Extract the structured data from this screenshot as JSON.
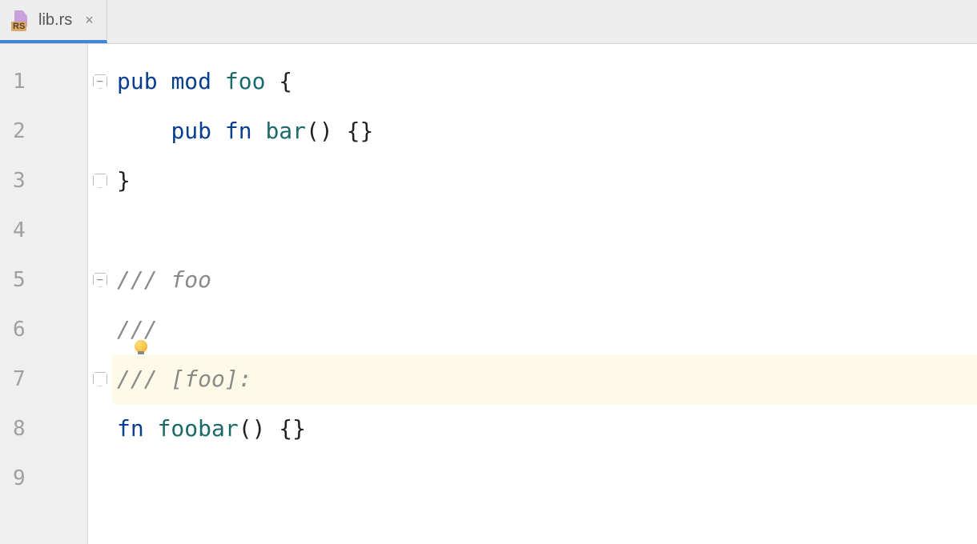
{
  "tab": {
    "filename": "lib.rs",
    "icon_badge": "RS"
  },
  "editor": {
    "highlighted_line_index": 6,
    "lines": [
      {
        "num": "1",
        "fold": "minus",
        "tokens": [
          {
            "t": "kw",
            "v": "pub"
          },
          {
            "t": "plain",
            "v": " "
          },
          {
            "t": "kw",
            "v": "mod"
          },
          {
            "t": "plain",
            "v": " "
          },
          {
            "t": "fnname",
            "v": "foo"
          },
          {
            "t": "plain",
            "v": " {"
          }
        ]
      },
      {
        "num": "2",
        "fold": null,
        "tokens": [
          {
            "t": "plain",
            "v": "    "
          },
          {
            "t": "kw",
            "v": "pub"
          },
          {
            "t": "plain",
            "v": " "
          },
          {
            "t": "kw",
            "v": "fn"
          },
          {
            "t": "plain",
            "v": " "
          },
          {
            "t": "fnname",
            "v": "bar"
          },
          {
            "t": "plain",
            "v": "() {}"
          }
        ]
      },
      {
        "num": "3",
        "fold": "close",
        "tokens": [
          {
            "t": "plain",
            "v": "}"
          }
        ]
      },
      {
        "num": "4",
        "fold": null,
        "tokens": []
      },
      {
        "num": "5",
        "fold": "minus",
        "tokens": [
          {
            "t": "comment",
            "v": "/// foo"
          }
        ]
      },
      {
        "num": "6",
        "fold": null,
        "bulb": true,
        "tokens": [
          {
            "t": "comment",
            "v": "///"
          }
        ]
      },
      {
        "num": "7",
        "fold": "close",
        "tokens": [
          {
            "t": "comment",
            "v": "/// [foo]:"
          }
        ]
      },
      {
        "num": "8",
        "fold": null,
        "tokens": [
          {
            "t": "kw",
            "v": "fn"
          },
          {
            "t": "plain",
            "v": " "
          },
          {
            "t": "fnname",
            "v": "foobar"
          },
          {
            "t": "plain",
            "v": "() {}"
          }
        ]
      },
      {
        "num": "9",
        "fold": null,
        "tokens": []
      }
    ]
  }
}
